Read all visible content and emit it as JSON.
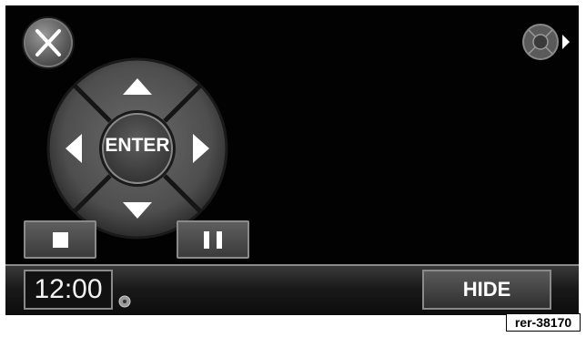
{
  "controls": {
    "enter_label": "ENTER",
    "hide_label": "HIDE",
    "clock": "12:00"
  },
  "icons": {
    "close": "close-icon",
    "dpad_toggle": "dpad-toggle-icon",
    "up": "arrow-up-icon",
    "down": "arrow-down-icon",
    "left": "arrow-left-icon",
    "right": "arrow-right-icon",
    "stop": "stop-icon",
    "pause": "pause-icon",
    "disc": "disc-icon"
  },
  "colors": {
    "background": "#020202",
    "button": "#555555",
    "text": "#ffffff"
  },
  "reference": "rer-38170"
}
